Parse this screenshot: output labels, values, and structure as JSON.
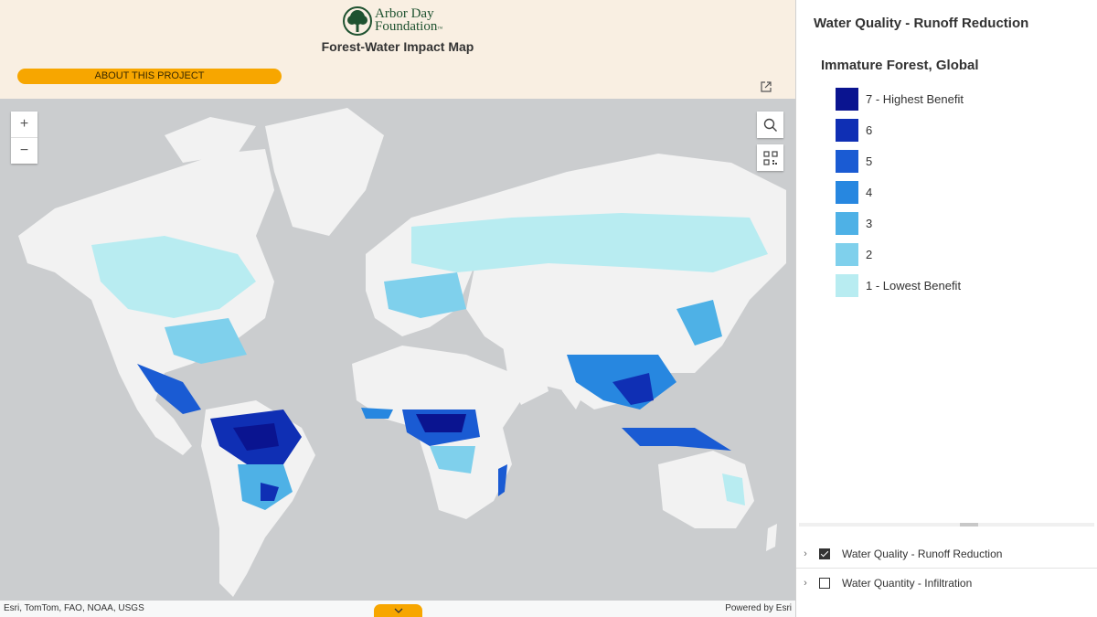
{
  "header": {
    "logo_line1": "Arbor Day",
    "logo_line2": "Foundation",
    "logo_tm": "™",
    "map_title": "Forest-Water Impact Map",
    "about_button": "ABOUT THIS PROJECT"
  },
  "map": {
    "zoom_in": "+",
    "zoom_out": "−",
    "attribution_left": "Esri, TomTom, FAO, NOAA, USGS",
    "attribution_right": "Powered by Esri",
    "colors": {
      "ocean": "#cbcdcf",
      "land": "#f2f2f2",
      "accent": "#f7a600"
    }
  },
  "panel": {
    "title": "Water Quality - Runoff Reduction",
    "legend_title": "Immature Forest, Global",
    "legend": [
      {
        "label": "7 - Highest Benefit",
        "color": "#0a1490"
      },
      {
        "label": "6",
        "color": "#0f2fb4"
      },
      {
        "label": "5",
        "color": "#1a5bd3"
      },
      {
        "label": "4",
        "color": "#2787e0"
      },
      {
        "label": "3",
        "color": "#4eb1e6"
      },
      {
        "label": "2",
        "color": "#7fd0ec"
      },
      {
        "label": "1 - Lowest Benefit",
        "color": "#b8ecf1"
      }
    ],
    "layers": [
      {
        "label": "Water Quality - Runoff Reduction",
        "checked": true
      },
      {
        "label": "Water Quantity - Infiltration",
        "checked": false
      }
    ]
  }
}
